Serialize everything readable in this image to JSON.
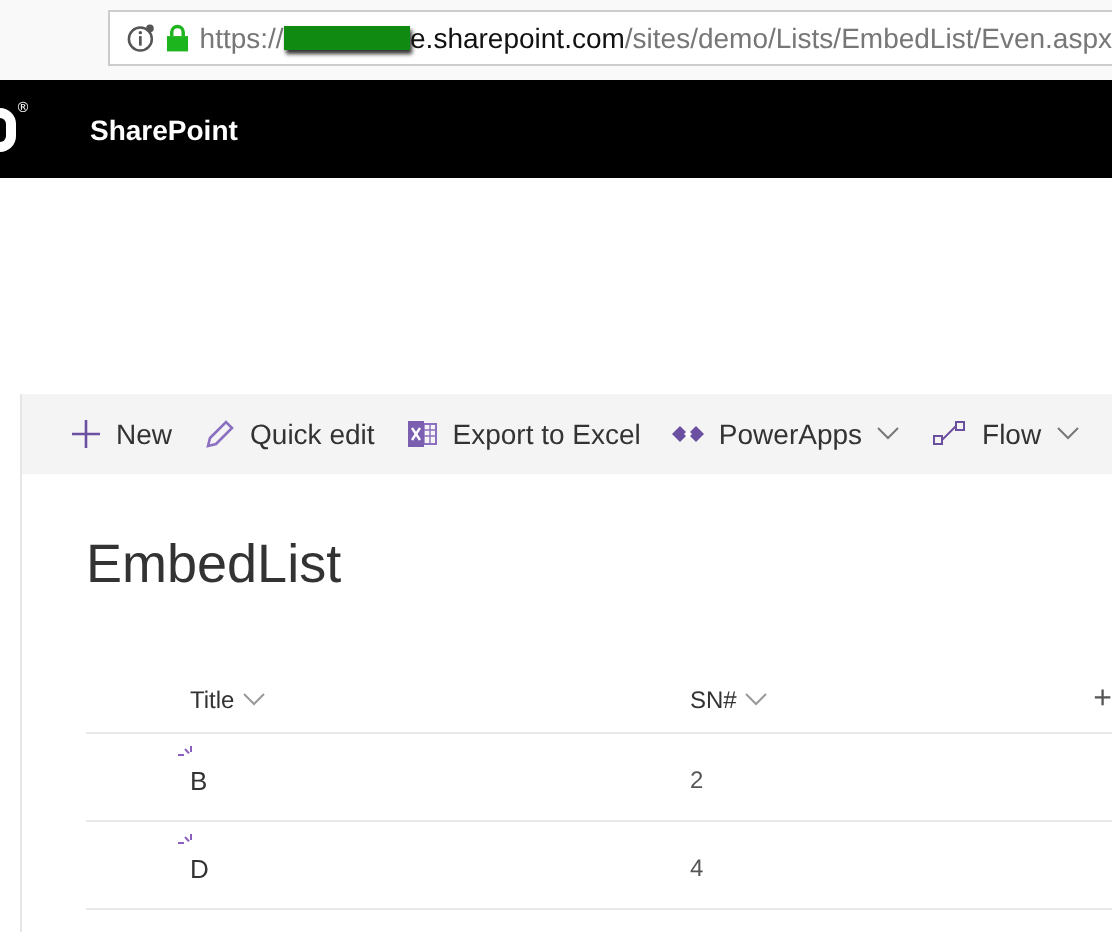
{
  "address_bar": {
    "scheme": "https://",
    "host": "e.sharepoint.com",
    "path": "/sites/demo/Lists/EmbedList/Even.aspx"
  },
  "suite_bar": {
    "logo_mark": "®",
    "app_name": "SharePoint"
  },
  "command_bar": [
    {
      "label": "New",
      "kind": "plus",
      "has_menu": false
    },
    {
      "label": "Quick edit",
      "kind": "pencil",
      "has_menu": false
    },
    {
      "label": "Export to Excel",
      "kind": "excel",
      "has_menu": false
    },
    {
      "label": "PowerApps",
      "kind": "powerapps",
      "has_menu": true
    },
    {
      "label": "Flow",
      "kind": "flow",
      "has_menu": true
    }
  ],
  "list": {
    "title": "EmbedList",
    "columns": [
      {
        "label": "Title"
      },
      {
        "label": "SN#"
      }
    ],
    "add_column": "+",
    "rows": [
      {
        "title": "B",
        "sn": "2",
        "is_new": true
      },
      {
        "title": "D",
        "sn": "4",
        "is_new": true
      }
    ]
  }
}
